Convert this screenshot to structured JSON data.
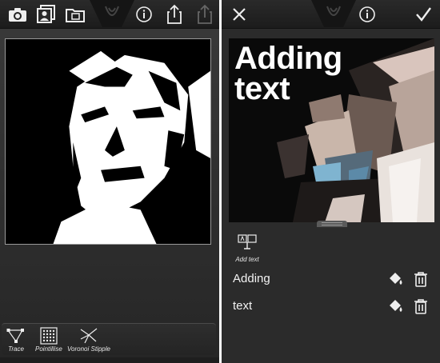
{
  "left_screen": {
    "toolbar": {
      "icons": [
        "camera-icon",
        "photos-icon",
        "folder-icon",
        "app-logo-icon",
        "info-icon",
        "share-icon",
        "upload-icon"
      ]
    },
    "filters": [
      {
        "label": "Trace",
        "icon": "trace-icon"
      },
      {
        "label": "Pointillise",
        "icon": "pointillise-icon"
      },
      {
        "label": "Voronoi Stipple",
        "icon": "voronoi-stipple-icon"
      }
    ]
  },
  "right_screen": {
    "toolbar": {
      "icons": [
        "close-icon",
        "app-logo-icon",
        "info-icon",
        "checkmark-icon"
      ]
    },
    "preview": {
      "text_lines": [
        "Adding",
        "text"
      ]
    },
    "add_text": {
      "label": "Add text",
      "icon": "add-text-icon"
    },
    "text_layers": [
      {
        "name": "Adding",
        "actions": [
          "color-fill-icon",
          "trash-icon"
        ]
      },
      {
        "name": "text",
        "actions": [
          "color-fill-icon",
          "trash-icon"
        ]
      }
    ]
  },
  "colors": {
    "toolbar": "#1c1c1c",
    "background": "#2e2e2e",
    "accent_text": "#ffffff"
  }
}
